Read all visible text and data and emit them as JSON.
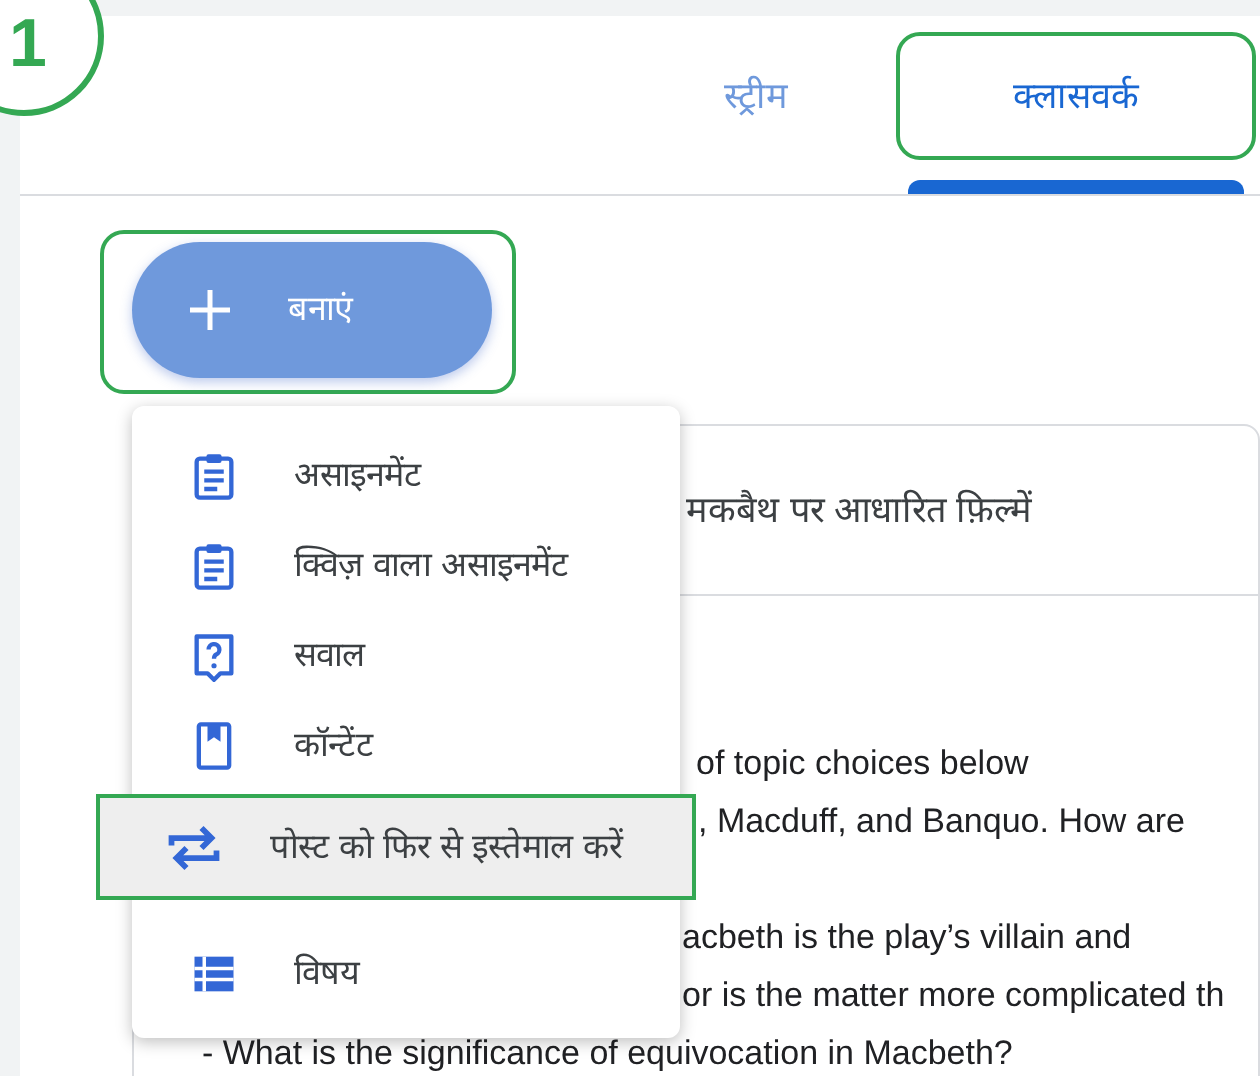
{
  "step_badge": "1",
  "tabs": [
    {
      "label": "स्ट्रीम",
      "selected": false,
      "highlighted": false
    },
    {
      "label": "क्लासवर्क",
      "selected": true,
      "highlighted": true
    }
  ],
  "create_button": {
    "label": "बनाएं",
    "highlighted": true
  },
  "post_card": {
    "title": "मकबैथ पर आधारित फ़िल्में",
    "paragraphs": [
      [
        "of topic choices below",
        ", Macduff, and Banquo. How are"
      ],
      [
        "acbeth is the play’s villain and",
        "or is the matter more complicated th",
        "- What is the significance of equivocation in Macbeth?"
      ]
    ]
  },
  "create_menu": {
    "items": [
      {
        "label": "असाइनमेंट",
        "kind": "assignment",
        "selected": false,
        "highlighted": false
      },
      {
        "label": "क्विज़ वाला असाइनमेंट",
        "kind": "quiz",
        "selected": false,
        "highlighted": false
      },
      {
        "label": "सवाल",
        "kind": "question",
        "selected": false,
        "highlighted": false
      },
      {
        "label": "कॉन्टेंट",
        "kind": "material",
        "selected": false,
        "highlighted": false
      },
      {
        "label": "पोस्ट को फिर से इस्तेमाल करें",
        "kind": "reuse",
        "selected": true,
        "highlighted": true
      },
      {
        "label": "विषय",
        "kind": "topic",
        "selected": false,
        "highlighted": false
      }
    ]
  }
}
